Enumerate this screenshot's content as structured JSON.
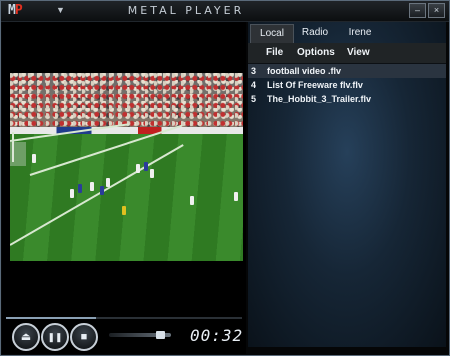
{
  "titlebar": {
    "logo_m": "M",
    "logo_p": "P",
    "app_title": "METAL PLAYER",
    "menu_icon": "dropdown-triangle-icon",
    "minimize_glyph": "–",
    "close_glyph": "×"
  },
  "playback": {
    "time": "00:32",
    "progress_fraction": 0.38,
    "volume_fraction": 0.88,
    "eject_glyph": "⏏",
    "pause_glyph": "❚❚",
    "stop_glyph": "■"
  },
  "tabs": [
    {
      "label": "Local",
      "active": true
    },
    {
      "label": "Radio",
      "active": false
    },
    {
      "label": "Irene",
      "active": false
    }
  ],
  "subnav": {
    "file": "File",
    "options": "Options",
    "view": "View"
  },
  "playlist": [
    {
      "num": "3",
      "title": "football video .flv",
      "selected": true
    },
    {
      "num": "4",
      "title": "List Of Freeware flv.flv",
      "selected": false
    },
    {
      "num": "5",
      "title": "The_Hobbit_3_Trailer.flv",
      "selected": false
    }
  ],
  "colors": {
    "accent": "#e23020",
    "panel_glow": "#26405a",
    "text": "#f0f4f8"
  }
}
